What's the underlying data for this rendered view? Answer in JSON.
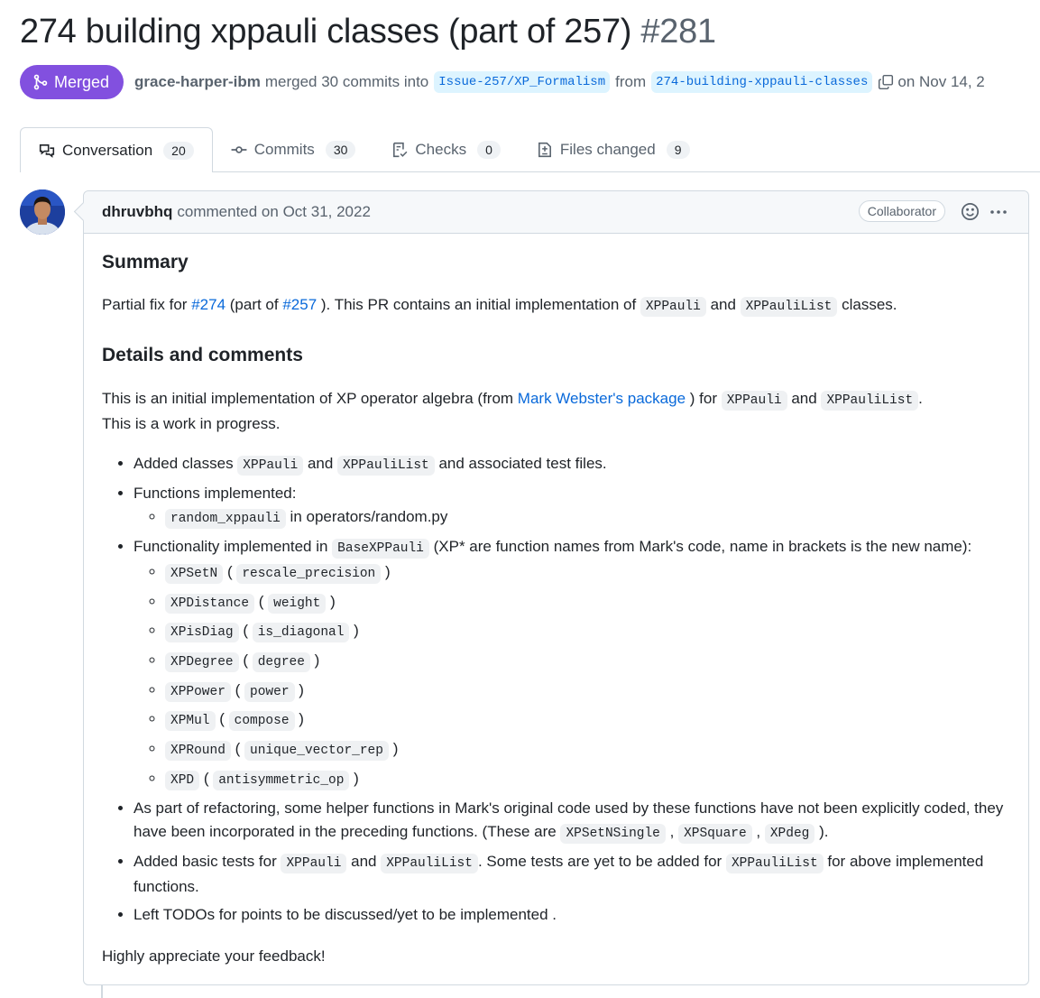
{
  "pr": {
    "title": "274 building xppauli classes (part of 257)",
    "number": "#281",
    "state": "Merged",
    "author": "grace-harper-ibm",
    "merged_text": "merged 30 commits into",
    "base_branch": "Issue-257/XP_Formalism",
    "from_text": "from",
    "head_branch": "274-building-xppauli-classes",
    "date_text": "on Nov 14, 2"
  },
  "tabs": [
    {
      "label": "Conversation",
      "count": "20",
      "icon": "comment-discussion-icon"
    },
    {
      "label": "Commits",
      "count": "30",
      "icon": "git-commit-icon"
    },
    {
      "label": "Checks",
      "count": "0",
      "icon": "checklist-icon"
    },
    {
      "label": "Files changed",
      "count": "9",
      "icon": "file-diff-icon"
    }
  ],
  "comment": {
    "author": "dhruvbhq",
    "meta": "commented on Oct 31, 2022",
    "role": "Collaborator",
    "summary_heading": "Summary",
    "summary": {
      "t1": "Partial fix for ",
      "link1": "#274",
      "t2": " (part of ",
      "link2": "#257",
      "t3": " ). This PR contains an initial implementation of ",
      "c1": "XPPauli",
      "t4": " and ",
      "c2": "XPPauliList",
      "t5": " classes."
    },
    "details_heading": "Details and comments",
    "details": {
      "t1": "This is an initial implementation of XP operator algebra (from ",
      "link": "Mark Webster's package",
      "t2": " ) for ",
      "c1": "XPPauli",
      "t3": " and ",
      "c2": "XPPauliList",
      "t4": ".",
      "line2": "This is a work in progress."
    },
    "bullets": {
      "b1": {
        "t1": "Added classes ",
        "c1": "XPPauli",
        "t2": " and ",
        "c2": "XPPauliList",
        "t3": " and associated test files."
      },
      "b2": {
        "t1": "Functions implemented:",
        "sub_code": "random_xppauli",
        "sub_text": " in operators/random.py"
      },
      "b3": {
        "t1": "Functionality implemented in ",
        "c1": "BaseXPPauli",
        "t2": " (XP* are function names from Mark's code, name in brackets is the new name):"
      },
      "mappings": [
        {
          "xp": "XPSetN",
          "new": "rescale_precision"
        },
        {
          "xp": "XPDistance",
          "new": "weight"
        },
        {
          "xp": "XPisDiag",
          "new": "is_diagonal"
        },
        {
          "xp": "XPDegree",
          "new": "degree"
        },
        {
          "xp": "XPPower",
          "new": "power"
        },
        {
          "xp": "XPMul",
          "new": "compose"
        },
        {
          "xp": "XPRound",
          "new": "unique_vector_rep"
        },
        {
          "xp": "XPD",
          "new": "antisymmetric_op"
        }
      ],
      "b4": {
        "t1": "As part of refactoring, some helper functions in Mark's original code used by these functions have not been explicitly coded, they have been incorporated in the preceding functions. (These are ",
        "c1": "XPSetNSingle",
        "t2": " , ",
        "c2": "XPSquare",
        "t3": " , ",
        "c3": "XPdeg",
        "t4": " )."
      },
      "b5": {
        "t1": "Added basic tests for ",
        "c1": "XPPauli",
        "t2": " and ",
        "c2": "XPPauliList",
        "t3": ". Some tests are yet to be added for ",
        "c3": "XPPauliList",
        "t4": " for above implemented functions."
      },
      "b6": {
        "t1": "Left TODOs for points to be discussed/yet to be implemented ."
      }
    },
    "closing": "Highly appreciate your feedback!"
  },
  "colors": {
    "merged": "#8250df",
    "link": "#0969da",
    "branch_bg": "#ddf4ff"
  }
}
